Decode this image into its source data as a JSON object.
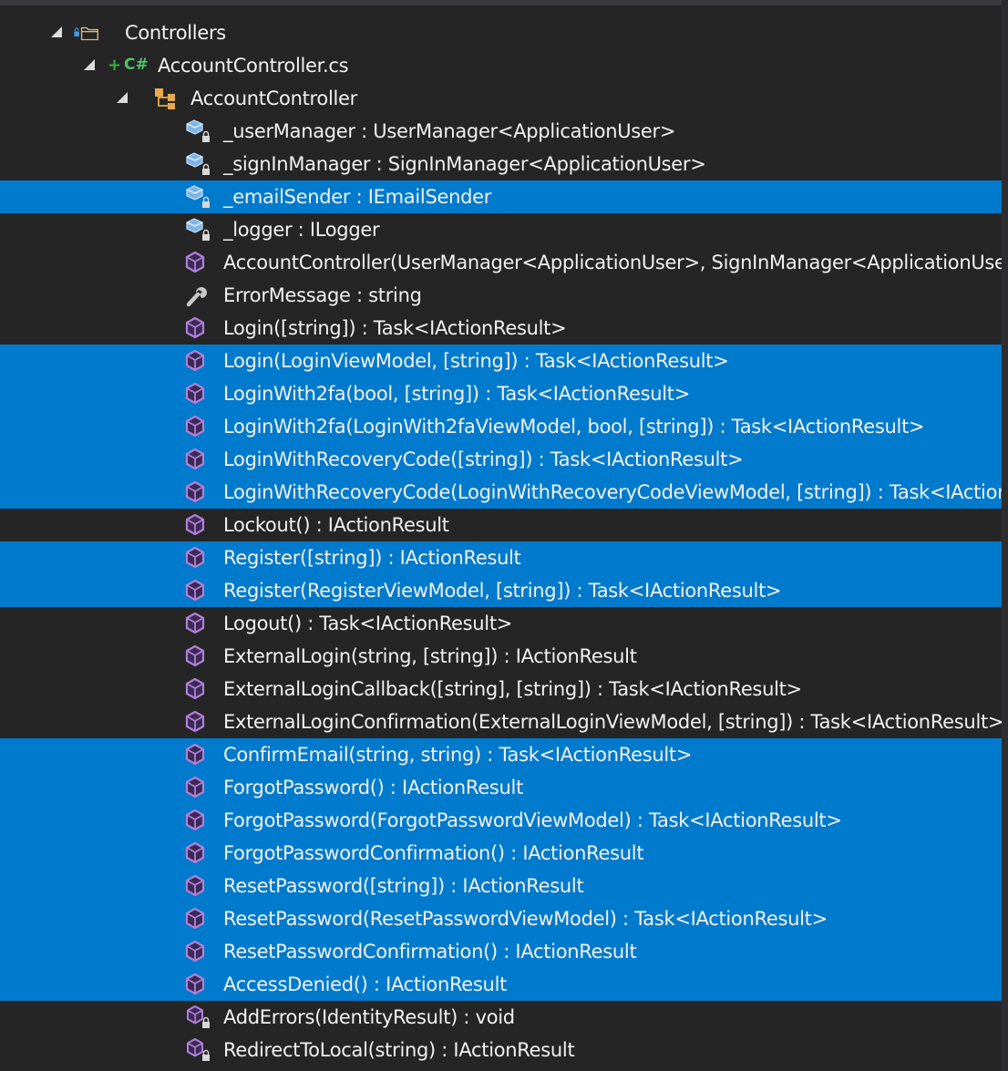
{
  "folder": {
    "label": "Controllers",
    "icon": "folder-lock-icon"
  },
  "file": {
    "label": "AccountController.cs",
    "status_mark": "+",
    "language_badge": "C#",
    "icon": "csharp-file-icon"
  },
  "class_node": {
    "label": "AccountController",
    "icon": "class-icon"
  },
  "members": [
    {
      "label": "_userManager : UserManager<ApplicationUser>",
      "kind": "private-field",
      "icon": "private-field-icon",
      "selected": false
    },
    {
      "label": "_signInManager : SignInManager<ApplicationUser>",
      "kind": "private-field",
      "icon": "private-field-icon",
      "selected": false
    },
    {
      "label": "_emailSender : IEmailSender",
      "kind": "private-field",
      "icon": "private-field-icon",
      "selected": true
    },
    {
      "label": "_logger : ILogger",
      "kind": "private-field",
      "icon": "private-field-icon",
      "selected": false
    },
    {
      "label": "AccountController(UserManager<ApplicationUser>, SignInManager<ApplicationUser>, IEmailSender, ILogger<AccountController>)",
      "kind": "method",
      "icon": "method-icon",
      "selected": false
    },
    {
      "label": "ErrorMessage : string",
      "kind": "property",
      "icon": "property-wrench-icon",
      "selected": false
    },
    {
      "label": "Login([string]) : Task<IActionResult>",
      "kind": "method",
      "icon": "method-icon",
      "selected": false
    },
    {
      "label": "Login(LoginViewModel, [string]) : Task<IActionResult>",
      "kind": "method",
      "icon": "method-icon",
      "selected": true
    },
    {
      "label": "LoginWith2fa(bool, [string]) : Task<IActionResult>",
      "kind": "method",
      "icon": "method-icon",
      "selected": true
    },
    {
      "label": "LoginWith2fa(LoginWith2faViewModel, bool, [string]) : Task<IActionResult>",
      "kind": "method",
      "icon": "method-icon",
      "selected": true
    },
    {
      "label": "LoginWithRecoveryCode([string]) : Task<IActionResult>",
      "kind": "method",
      "icon": "method-icon",
      "selected": true
    },
    {
      "label": "LoginWithRecoveryCode(LoginWithRecoveryCodeViewModel, [string]) : Task<IActionResult>",
      "kind": "method",
      "icon": "method-icon",
      "selected": true
    },
    {
      "label": "Lockout() : IActionResult",
      "kind": "method",
      "icon": "method-icon",
      "selected": false
    },
    {
      "label": "Register([string]) : IActionResult",
      "kind": "method",
      "icon": "method-icon",
      "selected": true
    },
    {
      "label": "Register(RegisterViewModel, [string]) : Task<IActionResult>",
      "kind": "method",
      "icon": "method-icon",
      "selected": true
    },
    {
      "label": "Logout() : Task<IActionResult>",
      "kind": "method",
      "icon": "method-icon",
      "selected": false
    },
    {
      "label": "ExternalLogin(string, [string]) : IActionResult",
      "kind": "method",
      "icon": "method-icon",
      "selected": false
    },
    {
      "label": "ExternalLoginCallback([string], [string]) : Task<IActionResult>",
      "kind": "method",
      "icon": "method-icon",
      "selected": false
    },
    {
      "label": "ExternalLoginConfirmation(ExternalLoginViewModel, [string]) : Task<IActionResult>",
      "kind": "method",
      "icon": "method-icon",
      "selected": false
    },
    {
      "label": "ConfirmEmail(string, string) : Task<IActionResult>",
      "kind": "method",
      "icon": "method-icon",
      "selected": true
    },
    {
      "label": "ForgotPassword() : IActionResult",
      "kind": "method",
      "icon": "method-icon",
      "selected": true
    },
    {
      "label": "ForgotPassword(ForgotPasswordViewModel) : Task<IActionResult>",
      "kind": "method",
      "icon": "method-icon",
      "selected": true
    },
    {
      "label": "ForgotPasswordConfirmation() : IActionResult",
      "kind": "method",
      "icon": "method-icon",
      "selected": true
    },
    {
      "label": "ResetPassword([string]) : IActionResult",
      "kind": "method",
      "icon": "method-icon",
      "selected": true
    },
    {
      "label": "ResetPassword(ResetPasswordViewModel) : Task<IActionResult>",
      "kind": "method",
      "icon": "method-icon",
      "selected": true
    },
    {
      "label": "ResetPasswordConfirmation() : IActionResult",
      "kind": "method",
      "icon": "method-icon",
      "selected": true
    },
    {
      "label": "AccessDenied() : IActionResult",
      "kind": "method",
      "icon": "method-icon",
      "selected": true
    },
    {
      "label": "AddErrors(IdentityResult) : void",
      "kind": "private-method",
      "icon": "private-method-icon",
      "selected": false
    },
    {
      "label": "RedirectToLocal(string) : IActionResult",
      "kind": "private-method",
      "icon": "private-method-icon",
      "selected": false
    }
  ],
  "colors": {
    "background": "#252526",
    "selection": "#007acc",
    "text": "#f1f1f1",
    "method_icon": "#b180d7",
    "field_icon": "#7fb6e8",
    "folder_icon": "#dcb67a",
    "csharp_badge": "#4fc46b"
  }
}
